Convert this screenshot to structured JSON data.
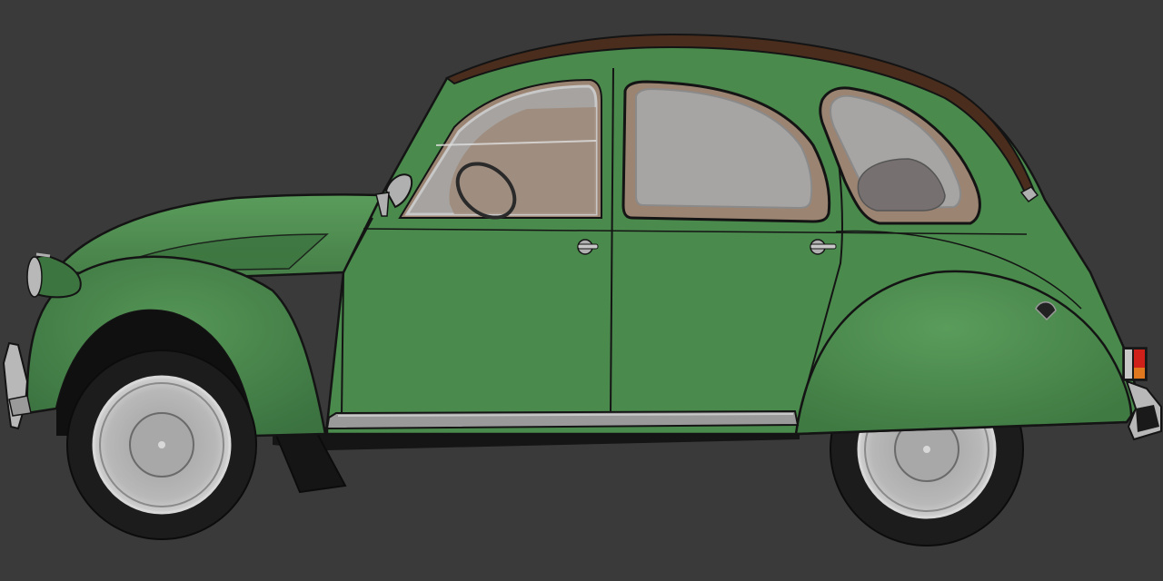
{
  "scene": {
    "subject": "car-side-view",
    "colors": {
      "background": "#3a3a3a",
      "body": "#4a8a4c",
      "body_shadow": "#3d7540",
      "body_highlight": "#5a9c5b",
      "roof": "#4a2d1c",
      "window_frame": "#9c8472",
      "glass": "#a8a8a8",
      "chrome": "#b0b0b0",
      "chrome_dark": "#7c7c7c",
      "tire": "#1b1b1b",
      "wheel_well": "#101010",
      "rim": "#b8b8b8",
      "outline": "#141414",
      "tail_light_red": "#d0201a",
      "tail_light_amber": "#e07820"
    }
  }
}
